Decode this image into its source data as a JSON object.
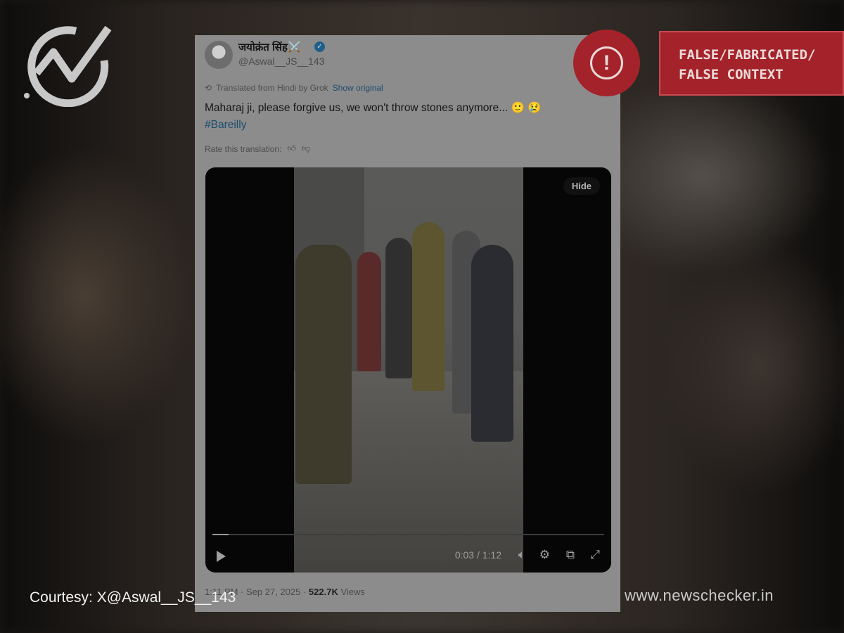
{
  "tweet": {
    "display_name": "जयोक्रंत सिंह⚔️",
    "handle": "@Aswal__JS__143",
    "translated_note": "Translated from Hindi by Grok",
    "show_original": "Show original",
    "text": "Maharaj ji, please forgive us, we won't throw stones anymore... 🙂 😢",
    "hashtag": "#Bareilly",
    "rate_label": "Rate this translation:",
    "timestamp": "1:11 PM · Sep 27, 2025 ·",
    "views_count": "522.7K",
    "views_label": "Views"
  },
  "video": {
    "hide_label": "Hide",
    "time": "0:03 / 1:12",
    "progress_fraction": 0.042
  },
  "verdict": {
    "line1": "FALSE/FABRICATED/",
    "line2": "FALSE CONTEXT",
    "color": "#a4232a"
  },
  "footer": {
    "courtesy": "Courtesy: X@Aswal__JS__143",
    "site": "www.newschecker.in"
  },
  "icons": [
    "newschecker-logo-icon",
    "verified-icon",
    "translate-icon",
    "thumbs-up-icon",
    "thumbs-down-icon",
    "play-icon",
    "volume-icon",
    "settings-icon",
    "pip-icon",
    "fullscreen-icon",
    "alert-icon"
  ]
}
